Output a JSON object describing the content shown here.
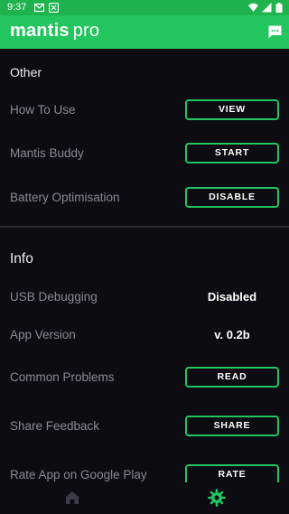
{
  "status_bar": {
    "time": "9:37",
    "icons": [
      "gmail-notification-icon",
      "app-notification-icon",
      "wifi-icon",
      "signal-icon",
      "battery-icon"
    ]
  },
  "app_bar": {
    "brand": "mantis",
    "brand_suffix": "pro",
    "action_icon": "chat-icon",
    "color": "#22c55e"
  },
  "sections": {
    "other": {
      "title": "Other",
      "how_to_use": {
        "label": "How To Use",
        "button": "VIEW"
      },
      "mantis_buddy": {
        "label": "Mantis Buddy",
        "button": "START"
      },
      "battery": {
        "label": "Battery Optimisation",
        "button": "DISABLE"
      }
    },
    "info": {
      "title": "Info",
      "usb": {
        "label": "USB Debugging",
        "value": "Disabled"
      },
      "version": {
        "label": "App Version",
        "value": "v. 0.2b"
      },
      "problems": {
        "label": "Common Problems",
        "button": "READ"
      },
      "feedback": {
        "label": "Share Feedback",
        "button": "SHARE"
      },
      "rate": {
        "label": "Rate App on Google Play",
        "button": "RATE"
      }
    }
  },
  "bottom_nav": {
    "items": [
      {
        "icon": "home-icon",
        "active": false
      },
      {
        "icon": "gear-icon",
        "active": true
      }
    ]
  },
  "colors": {
    "accent": "#22c55e",
    "background": "#0c0c12",
    "label": "#8a8a97"
  }
}
